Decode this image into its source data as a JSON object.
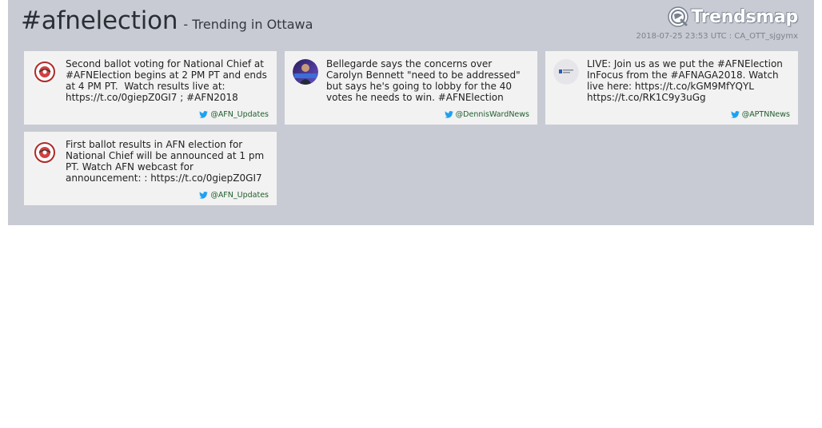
{
  "header": {
    "hashtag": "#afnelection",
    "subtitle": "- Trending in Ottawa",
    "brand": "Trendsmap",
    "meta": "2018-07-25 23:53 UTC : CA_OTT_sjgymx"
  },
  "tweets": [
    {
      "text": "Second ballot voting for National Chief at #AFNElection begins at 2 PM PT and ends at 4 PM PT.  Watch results live at: https://t.co/0giepZ0GI7 ; #AFN2018",
      "handle": "@AFN_Updates",
      "avatar": "afn-logo-icon"
    },
    {
      "text": "Bellegarde says the concerns over Carolyn Bennett \"need to be addressed\" but says he's going to lobby for the 40 votes he needs to win. #AFNElection",
      "handle": "@DennisWardNews",
      "avatar": "profile-photo-icon"
    },
    {
      "text": "LIVE: Join us as we put the #AFNElection InFocus from the #AFNAGA2018. Watch live here: https://t.co/kGM9MfYQYL https://t.co/RK1C9y3uGg",
      "handle": "@APTNNews",
      "avatar": "aptn-logo-icon"
    },
    {
      "text": "First ballot results in AFN election for National Chief will be announced at 1 pm PT. Watch AFN webcast for announcement: : https://t.co/0giepZ0GI7",
      "handle": "@AFN_Updates",
      "avatar": "afn-logo-icon"
    }
  ],
  "colors": {
    "panel": "#c8cbd3",
    "card": "#f2f2f2",
    "handle": "#1f5e2c",
    "twitter_blue": "#1da1f2"
  }
}
